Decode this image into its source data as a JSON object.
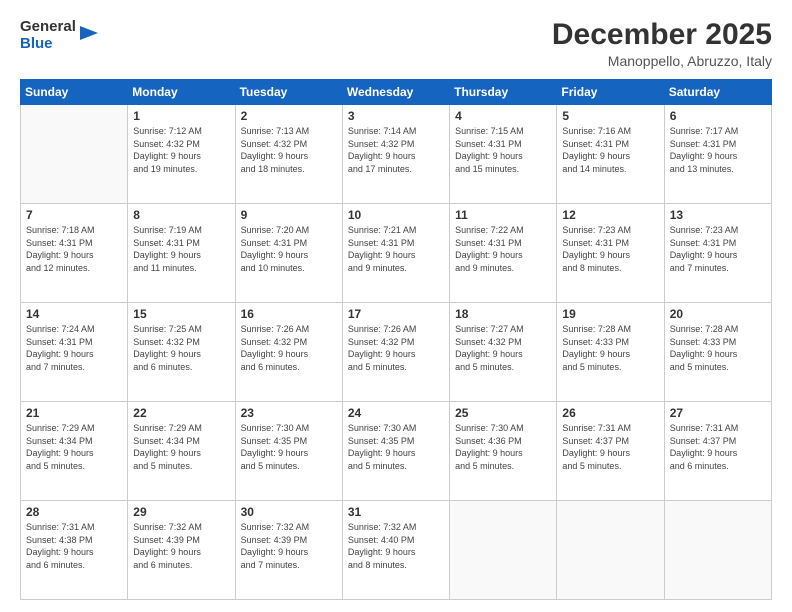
{
  "header": {
    "logo_general": "General",
    "logo_blue": "Blue",
    "month_title": "December 2025",
    "location": "Manoppello, Abruzzo, Italy"
  },
  "days_of_week": [
    "Sunday",
    "Monday",
    "Tuesday",
    "Wednesday",
    "Thursday",
    "Friday",
    "Saturday"
  ],
  "weeks": [
    [
      {
        "day": "",
        "info": ""
      },
      {
        "day": "1",
        "info": "Sunrise: 7:12 AM\nSunset: 4:32 PM\nDaylight: 9 hours\nand 19 minutes."
      },
      {
        "day": "2",
        "info": "Sunrise: 7:13 AM\nSunset: 4:32 PM\nDaylight: 9 hours\nand 18 minutes."
      },
      {
        "day": "3",
        "info": "Sunrise: 7:14 AM\nSunset: 4:32 PM\nDaylight: 9 hours\nand 17 minutes."
      },
      {
        "day": "4",
        "info": "Sunrise: 7:15 AM\nSunset: 4:31 PM\nDaylight: 9 hours\nand 15 minutes."
      },
      {
        "day": "5",
        "info": "Sunrise: 7:16 AM\nSunset: 4:31 PM\nDaylight: 9 hours\nand 14 minutes."
      },
      {
        "day": "6",
        "info": "Sunrise: 7:17 AM\nSunset: 4:31 PM\nDaylight: 9 hours\nand 13 minutes."
      }
    ],
    [
      {
        "day": "7",
        "info": "Sunrise: 7:18 AM\nSunset: 4:31 PM\nDaylight: 9 hours\nand 12 minutes."
      },
      {
        "day": "8",
        "info": "Sunrise: 7:19 AM\nSunset: 4:31 PM\nDaylight: 9 hours\nand 11 minutes."
      },
      {
        "day": "9",
        "info": "Sunrise: 7:20 AM\nSunset: 4:31 PM\nDaylight: 9 hours\nand 10 minutes."
      },
      {
        "day": "10",
        "info": "Sunrise: 7:21 AM\nSunset: 4:31 PM\nDaylight: 9 hours\nand 9 minutes."
      },
      {
        "day": "11",
        "info": "Sunrise: 7:22 AM\nSunset: 4:31 PM\nDaylight: 9 hours\nand 9 minutes."
      },
      {
        "day": "12",
        "info": "Sunrise: 7:23 AM\nSunset: 4:31 PM\nDaylight: 9 hours\nand 8 minutes."
      },
      {
        "day": "13",
        "info": "Sunrise: 7:23 AM\nSunset: 4:31 PM\nDaylight: 9 hours\nand 7 minutes."
      }
    ],
    [
      {
        "day": "14",
        "info": "Sunrise: 7:24 AM\nSunset: 4:31 PM\nDaylight: 9 hours\nand 7 minutes."
      },
      {
        "day": "15",
        "info": "Sunrise: 7:25 AM\nSunset: 4:32 PM\nDaylight: 9 hours\nand 6 minutes."
      },
      {
        "day": "16",
        "info": "Sunrise: 7:26 AM\nSunset: 4:32 PM\nDaylight: 9 hours\nand 6 minutes."
      },
      {
        "day": "17",
        "info": "Sunrise: 7:26 AM\nSunset: 4:32 PM\nDaylight: 9 hours\nand 5 minutes."
      },
      {
        "day": "18",
        "info": "Sunrise: 7:27 AM\nSunset: 4:32 PM\nDaylight: 9 hours\nand 5 minutes."
      },
      {
        "day": "19",
        "info": "Sunrise: 7:28 AM\nSunset: 4:33 PM\nDaylight: 9 hours\nand 5 minutes."
      },
      {
        "day": "20",
        "info": "Sunrise: 7:28 AM\nSunset: 4:33 PM\nDaylight: 9 hours\nand 5 minutes."
      }
    ],
    [
      {
        "day": "21",
        "info": "Sunrise: 7:29 AM\nSunset: 4:34 PM\nDaylight: 9 hours\nand 5 minutes."
      },
      {
        "day": "22",
        "info": "Sunrise: 7:29 AM\nSunset: 4:34 PM\nDaylight: 9 hours\nand 5 minutes."
      },
      {
        "day": "23",
        "info": "Sunrise: 7:30 AM\nSunset: 4:35 PM\nDaylight: 9 hours\nand 5 minutes."
      },
      {
        "day": "24",
        "info": "Sunrise: 7:30 AM\nSunset: 4:35 PM\nDaylight: 9 hours\nand 5 minutes."
      },
      {
        "day": "25",
        "info": "Sunrise: 7:30 AM\nSunset: 4:36 PM\nDaylight: 9 hours\nand 5 minutes."
      },
      {
        "day": "26",
        "info": "Sunrise: 7:31 AM\nSunset: 4:37 PM\nDaylight: 9 hours\nand 5 minutes."
      },
      {
        "day": "27",
        "info": "Sunrise: 7:31 AM\nSunset: 4:37 PM\nDaylight: 9 hours\nand 6 minutes."
      }
    ],
    [
      {
        "day": "28",
        "info": "Sunrise: 7:31 AM\nSunset: 4:38 PM\nDaylight: 9 hours\nand 6 minutes."
      },
      {
        "day": "29",
        "info": "Sunrise: 7:32 AM\nSunset: 4:39 PM\nDaylight: 9 hours\nand 6 minutes."
      },
      {
        "day": "30",
        "info": "Sunrise: 7:32 AM\nSunset: 4:39 PM\nDaylight: 9 hours\nand 7 minutes."
      },
      {
        "day": "31",
        "info": "Sunrise: 7:32 AM\nSunset: 4:40 PM\nDaylight: 9 hours\nand 8 minutes."
      },
      {
        "day": "",
        "info": ""
      },
      {
        "day": "",
        "info": ""
      },
      {
        "day": "",
        "info": ""
      }
    ]
  ]
}
